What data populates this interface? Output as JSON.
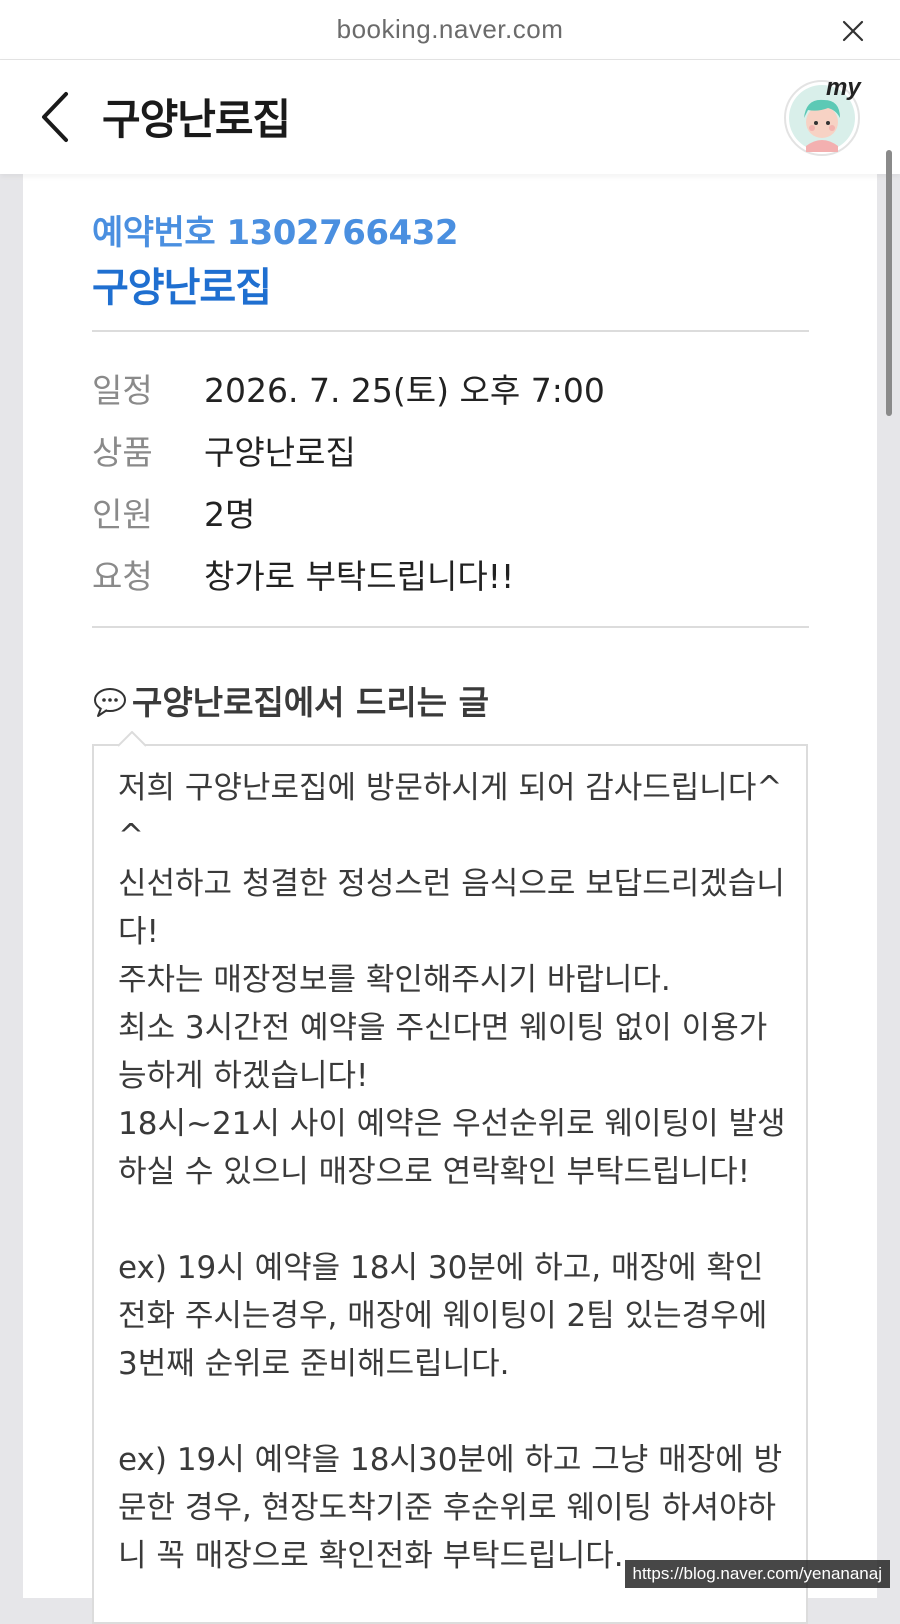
{
  "browser": {
    "url": "booking.naver.com"
  },
  "header": {
    "title": "구양난로집",
    "my_badge": "my"
  },
  "reservation": {
    "number_label": "예약번호 1302766432",
    "shop_name": "구양난로집",
    "rows": [
      {
        "label": "일정",
        "value": "2026. 7. 25(토) 오후 7:00"
      },
      {
        "label": "상품",
        "value": "구양난로집"
      },
      {
        "label": "인원",
        "value": "2명"
      },
      {
        "label": "요청",
        "value": "창가로 부탁드립니다!!"
      }
    ]
  },
  "message": {
    "title": "구양난로집에서 드리는 글",
    "body": "저희 구양난로집에 방문하시게 되어 감사드립니다^^\n신선하고 청결한 정성스런 음식으로 보답드리겠습니다!\n주차는 매장정보를 확인해주시기 바랍니다.\n최소 3시간전 예약을 주신다면 웨이팅 없이 이용가능하게 하겠습니다!\n18시~21시 사이 예약은 우선순위로 웨이팅이 발생하실 수 있으니 매장으로 연락확인 부탁드립니다!\n\nex) 19시 예약을 18시 30분에 하고, 매장에 확인전화 주시는경우, 매장에 웨이팅이 2팀 있는경우에 3번째 순위로 준비해드립니다.\n\nex) 19시 예약을 18시30분에 하고 그냥 매장에 방문한 경우, 현장도착기준 후순위로 웨이팅 하셔야하니 꼭 매장으로 확인전화 부탁드립니다."
  },
  "watermark": "https://blog.naver.com/yenananaj",
  "colors": {
    "reservation_number": "#4a8fe0",
    "shop_name": "#1f6fd0",
    "background": "#e6e6e9"
  },
  "icons": {
    "close": "close-icon",
    "back": "chevron-left-icon",
    "avatar": "avatar-icon",
    "speech_bubble": "speech-bubble-icon"
  }
}
